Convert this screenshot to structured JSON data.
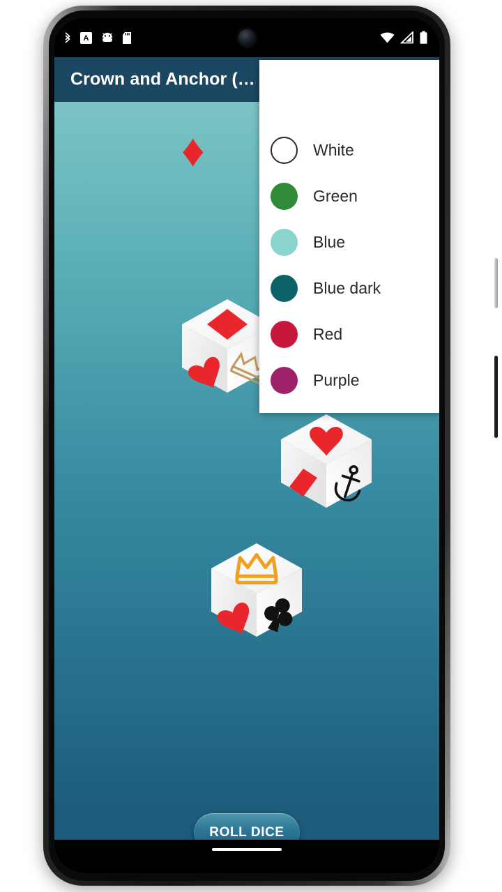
{
  "app": {
    "title": "Crown and Anchor (…",
    "appbar_color": "#1c4762",
    "background_top_color": "#7cc3c4",
    "background_bottom_color": "#1d567a"
  },
  "statusbar": {
    "left_icons": [
      "bluetooth-icon",
      "keyboard-a-icon",
      "android-head-icon",
      "sd-card-icon"
    ],
    "right_icons": [
      "wifi-icon",
      "cellular-signal-icon",
      "battery-icon"
    ]
  },
  "decorations": [
    {
      "name": "diamond",
      "glyph": "♦",
      "color": "#e8262c"
    },
    {
      "name": "heart",
      "glyph": "♥",
      "color": "#e8262c"
    },
    {
      "name": "club",
      "glyph": "♣",
      "color": "#111111"
    }
  ],
  "dice": [
    {
      "id": "die-1",
      "top_face": "diamond",
      "left_face": "heart",
      "right_face": "crown",
      "top_color": "#e8262c",
      "left_color": "#e8262c",
      "right_color": "#c59a62"
    },
    {
      "id": "die-2",
      "top_face": "heart",
      "left_face": "diamond",
      "right_face": "anchor",
      "top_color": "#e8262c",
      "left_color": "#e8262c",
      "right_color": "#111111"
    },
    {
      "id": "die-3",
      "top_face": "crown",
      "left_face": "heart",
      "right_face": "club",
      "top_color": "#f0a01e",
      "left_color": "#e8262c",
      "right_color": "#111111"
    }
  ],
  "roll_button": {
    "label": "ROLL DICE"
  },
  "menu": {
    "items": [
      {
        "label": "White",
        "color": "#ffffff",
        "outlined": true
      },
      {
        "label": "Green",
        "color": "#2f8a39",
        "outlined": false
      },
      {
        "label": "Blue",
        "color": "#8ad4ce",
        "outlined": false
      },
      {
        "label": "Blue dark",
        "color": "#0c6266",
        "outlined": false
      },
      {
        "label": "Red",
        "color": "#c8163c",
        "outlined": false
      },
      {
        "label": "Purple",
        "color": "#9d2269",
        "outlined": false
      }
    ]
  }
}
